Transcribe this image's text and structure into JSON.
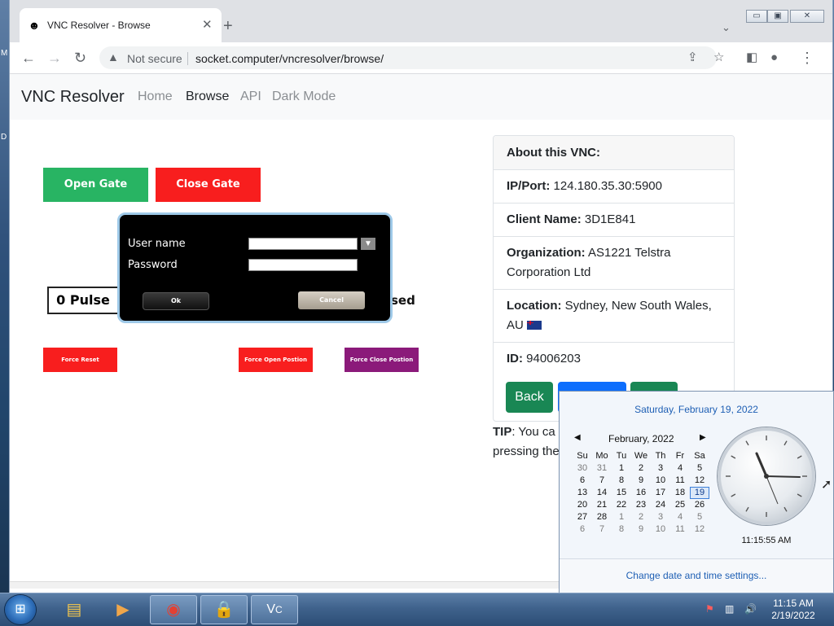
{
  "desktop": {
    "edge_labels": [
      "M",
      "D"
    ]
  },
  "browser": {
    "tab_title": "VNC Resolver - Browse",
    "new_tab": "+",
    "tab_close": "✕",
    "address": {
      "security": "Not secure",
      "url": "socket.computer/vncresolver/browse/"
    }
  },
  "navbar": {
    "brand": "VNC Resolver",
    "links": [
      "Home",
      "Browse",
      "API",
      "Dark Mode"
    ],
    "active": "Browse"
  },
  "vnc_screen": {
    "open_gate": "Open Gate",
    "close_gate": "Close Gate",
    "pulse": "0 Pulse",
    "partial_text": "sed",
    "force_reset": "Force Reset",
    "force_open": "Force Open Postion",
    "force_close": "Force Close Postion",
    "login": {
      "username_label": "User name",
      "password_label": "Password",
      "ok": "Ok",
      "cancel": "Cancel"
    }
  },
  "about": {
    "header": "About this VNC:",
    "ip_label": "IP/Port:",
    "ip_value": "124.180.35.30:5900",
    "client_label": "Client Name:",
    "client_value": "3D1E841",
    "org_label": "Organization:",
    "org_value": "AS1221 Telstra Corporation Ltd",
    "loc_label": "Location:",
    "loc_value": "Sydney, New South Wales, AU",
    "id_label": "ID:",
    "id_value": "94006203",
    "back": "Back",
    "tip_label": "TIP",
    "tip_line1": ": You ca",
    "tip_line2": "pressing the"
  },
  "clock_popup": {
    "full_date": "Saturday, February 19, 2022",
    "month": "February, 2022",
    "weekdays": [
      "Su",
      "Mo",
      "Tu",
      "We",
      "Th",
      "Fr",
      "Sa"
    ],
    "weeks": [
      [
        "30",
        "31",
        "1",
        "2",
        "3",
        "4",
        "5"
      ],
      [
        "6",
        "7",
        "8",
        "9",
        "10",
        "11",
        "12"
      ],
      [
        "13",
        "14",
        "15",
        "16",
        "17",
        "18",
        "19"
      ],
      [
        "20",
        "21",
        "22",
        "23",
        "24",
        "25",
        "26"
      ],
      [
        "27",
        "28",
        "1",
        "2",
        "3",
        "4",
        "5"
      ],
      [
        "6",
        "7",
        "8",
        "9",
        "10",
        "11",
        "12"
      ]
    ],
    "today": "19",
    "time": "11:15:55 AM",
    "link": "Change date and time settings..."
  },
  "taskbar": {
    "time": "11:15 AM",
    "date": "2/19/2022"
  },
  "colors": {
    "green": "#28b463",
    "red": "#f81e1e",
    "purple": "#8b1a7a",
    "bootstrap_green": "#198754",
    "bootstrap_blue": "#0d6efd"
  }
}
